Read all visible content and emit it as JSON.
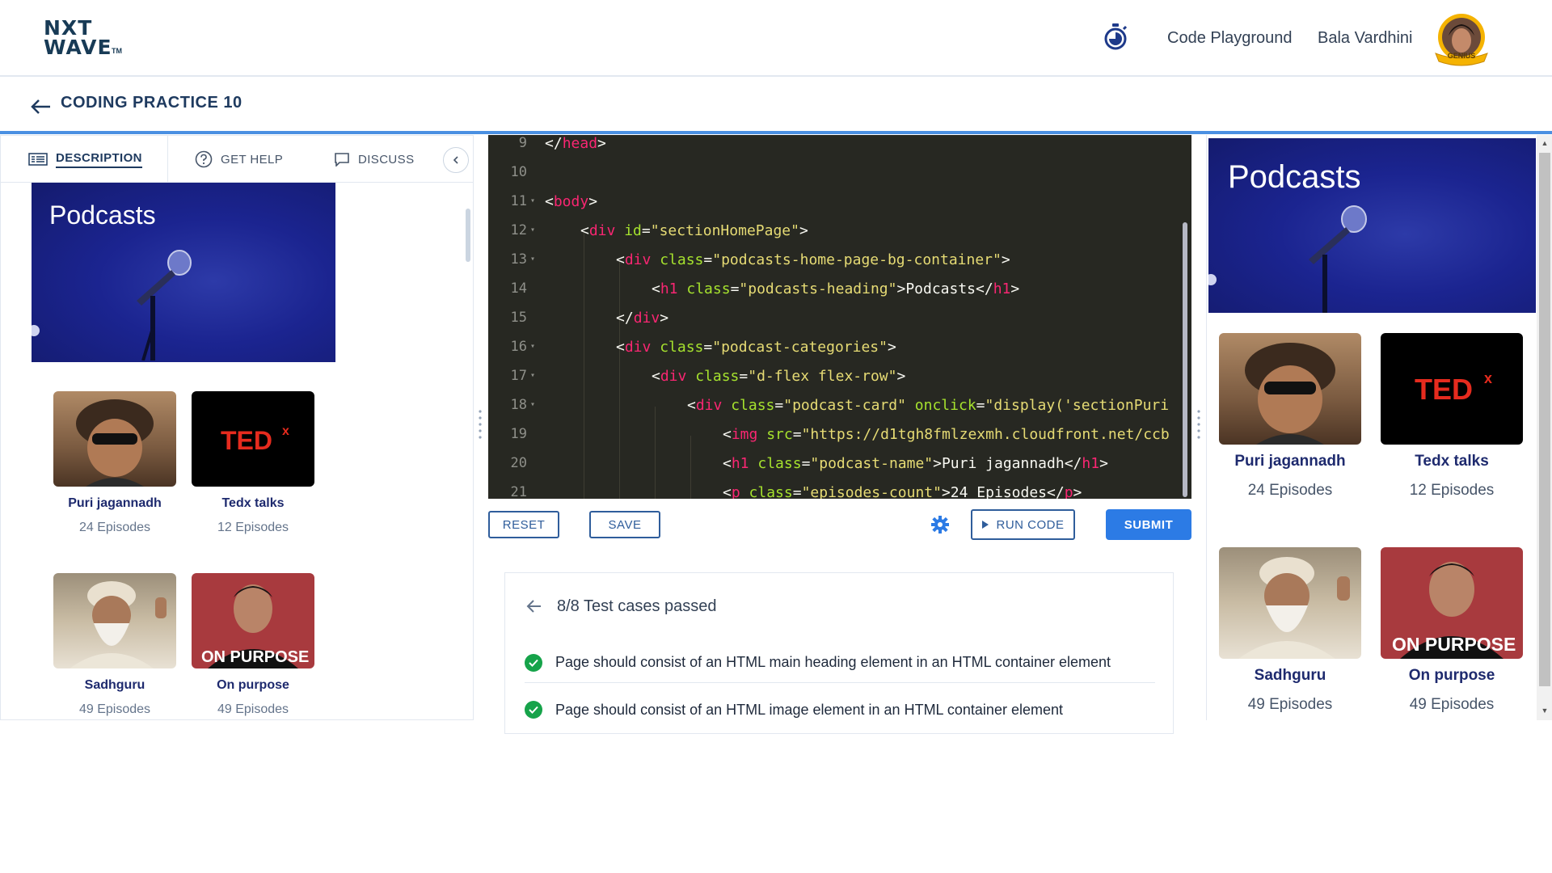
{
  "header": {
    "logo_line1": "NXT",
    "logo_line2": "WAVE",
    "logo_tm": "TM",
    "nav_code_playground": "Code Playground",
    "user_name": "Bala Vardhini",
    "avatar_badge": "GENIUS"
  },
  "page": {
    "title": "CODING PRACTICE 10"
  },
  "left_panel": {
    "tabs": [
      {
        "label": "DESCRIPTION",
        "icon": "description-icon",
        "active": true
      },
      {
        "label": "GET HELP",
        "icon": "help-icon",
        "active": false
      },
      {
        "label": "DISCUSS",
        "icon": "discuss-icon",
        "active": false
      }
    ],
    "hero_title": "Podcasts",
    "cards": [
      {
        "name": "Puri jagannadh",
        "episodes": "24 Episodes",
        "image": "person-portrait"
      },
      {
        "name": "Tedx talks",
        "episodes": "12 Episodes",
        "image": "tedx-logo"
      },
      {
        "name": "Sadhguru",
        "episodes": "49 Episodes",
        "image": "person-portrait"
      },
      {
        "name": "On purpose",
        "episodes": "49 Episodes",
        "image": "onpurpose-logo"
      }
    ]
  },
  "editor": {
    "lines": [
      {
        "n": "9",
        "fold": false
      },
      {
        "n": "10",
        "fold": false
      },
      {
        "n": "11",
        "fold": true
      },
      {
        "n": "12",
        "fold": true
      },
      {
        "n": "13",
        "fold": true
      },
      {
        "n": "14",
        "fold": false
      },
      {
        "n": "15",
        "fold": false
      },
      {
        "n": "16",
        "fold": true
      },
      {
        "n": "17",
        "fold": true
      },
      {
        "n": "18",
        "fold": true
      },
      {
        "n": "19",
        "fold": false
      },
      {
        "n": "20",
        "fold": false
      },
      {
        "n": "21",
        "fold": false
      }
    ],
    "code": {
      "l9": "head",
      "l11": "body",
      "l12_id": "\"sectionHomePage\"",
      "l13_class": "\"podcasts-home-page-bg-container\"",
      "l14_class": "\"podcasts-heading\"",
      "l14_text": "Podcasts",
      "l16_class": "\"podcast-categories\"",
      "l17_class": "\"d-flex flex-row\"",
      "l18_class": "\"podcast-card\"",
      "l18_onclick": "\"display('sectionPuri",
      "l19_src": "\"https://d1tgh8fmlzexmh.cloudfront.net/ccb",
      "l20_class": "\"podcast-name\"",
      "l20_text": "Puri jagannadh",
      "l21_class": "\"episodes-count\"",
      "l21_text": "24 Episodes"
    }
  },
  "toolbar": {
    "reset": "RESET",
    "save": "SAVE",
    "run": "RUN CODE",
    "submit": "SUBMIT"
  },
  "results": {
    "title": "8/8 Test cases passed",
    "tests": [
      "Page should consist of an HTML main heading element in an HTML container element",
      "Page should consist of an HTML image element in an HTML container element"
    ]
  },
  "preview": {
    "hero_title": "Podcasts",
    "cards": [
      {
        "name": "Puri jagannadh",
        "episodes": "24 Episodes"
      },
      {
        "name": "Tedx talks",
        "episodes": "12 Episodes"
      },
      {
        "name": "Sadhguru",
        "episodes": "49 Episodes"
      },
      {
        "name": "On purpose",
        "episodes": "49 Episodes"
      }
    ]
  },
  "colors": {
    "accent": "#2c7be5",
    "editor_bg": "#272822",
    "success": "#16a34a",
    "hero_bg": "#1b2490"
  }
}
